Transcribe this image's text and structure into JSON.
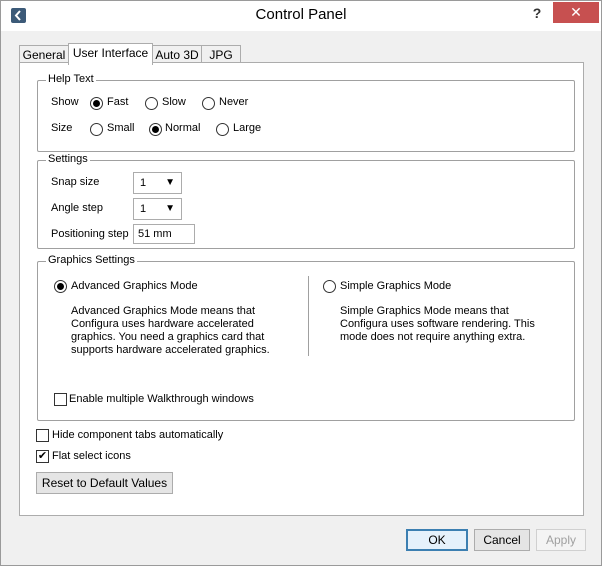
{
  "window": {
    "title": "Control Panel",
    "help": "?",
    "close": "✕"
  },
  "tabs": [
    {
      "label": "General"
    },
    {
      "label": "User Interface"
    },
    {
      "label": "Auto 3D"
    },
    {
      "label": "JPG"
    }
  ],
  "help_text": {
    "legend": "Help Text",
    "show_label": "Show",
    "show_options": [
      "Fast",
      "Slow",
      "Never"
    ],
    "show_selected": "Fast",
    "size_label": "Size",
    "size_options": [
      "Small",
      "Normal",
      "Large"
    ],
    "size_selected": "Normal"
  },
  "settings": {
    "legend": "Settings",
    "snap_label": "Snap size",
    "snap_value": "1",
    "angle_label": "Angle step",
    "angle_value": "1",
    "positioning_label": "Positioning step",
    "positioning_value": "51 mm"
  },
  "graphics": {
    "legend": "Graphics Settings",
    "advanced_label": "Advanced Graphics Mode",
    "advanced_desc_1": "Advanced Graphics Mode means that",
    "advanced_desc_2": "Configura uses hardware accelerated",
    "advanced_desc_3": "graphics. You need a graphics card that",
    "advanced_desc_4": "supports hardware accelerated graphics.",
    "simple_label": "Simple Graphics Mode",
    "simple_desc_1": "Simple Graphics Mode means that",
    "simple_desc_2": "Configura uses software rendering. This",
    "simple_desc_3": "mode does not require anything extra.",
    "selected": "Advanced Graphics Mode",
    "walkthrough_label": "Enable multiple Walkthrough windows",
    "walkthrough_checked": false
  },
  "options": {
    "hide_tabs_label": "Hide component tabs automatically",
    "hide_tabs_checked": false,
    "flat_icons_label": "Flat select icons",
    "flat_icons_checked": true,
    "reset_label": "Reset to Default Values"
  },
  "footer": {
    "ok": "OK",
    "cancel": "Cancel",
    "apply": "Apply"
  },
  "check_mark": "✔",
  "combo_arrow": "▼"
}
